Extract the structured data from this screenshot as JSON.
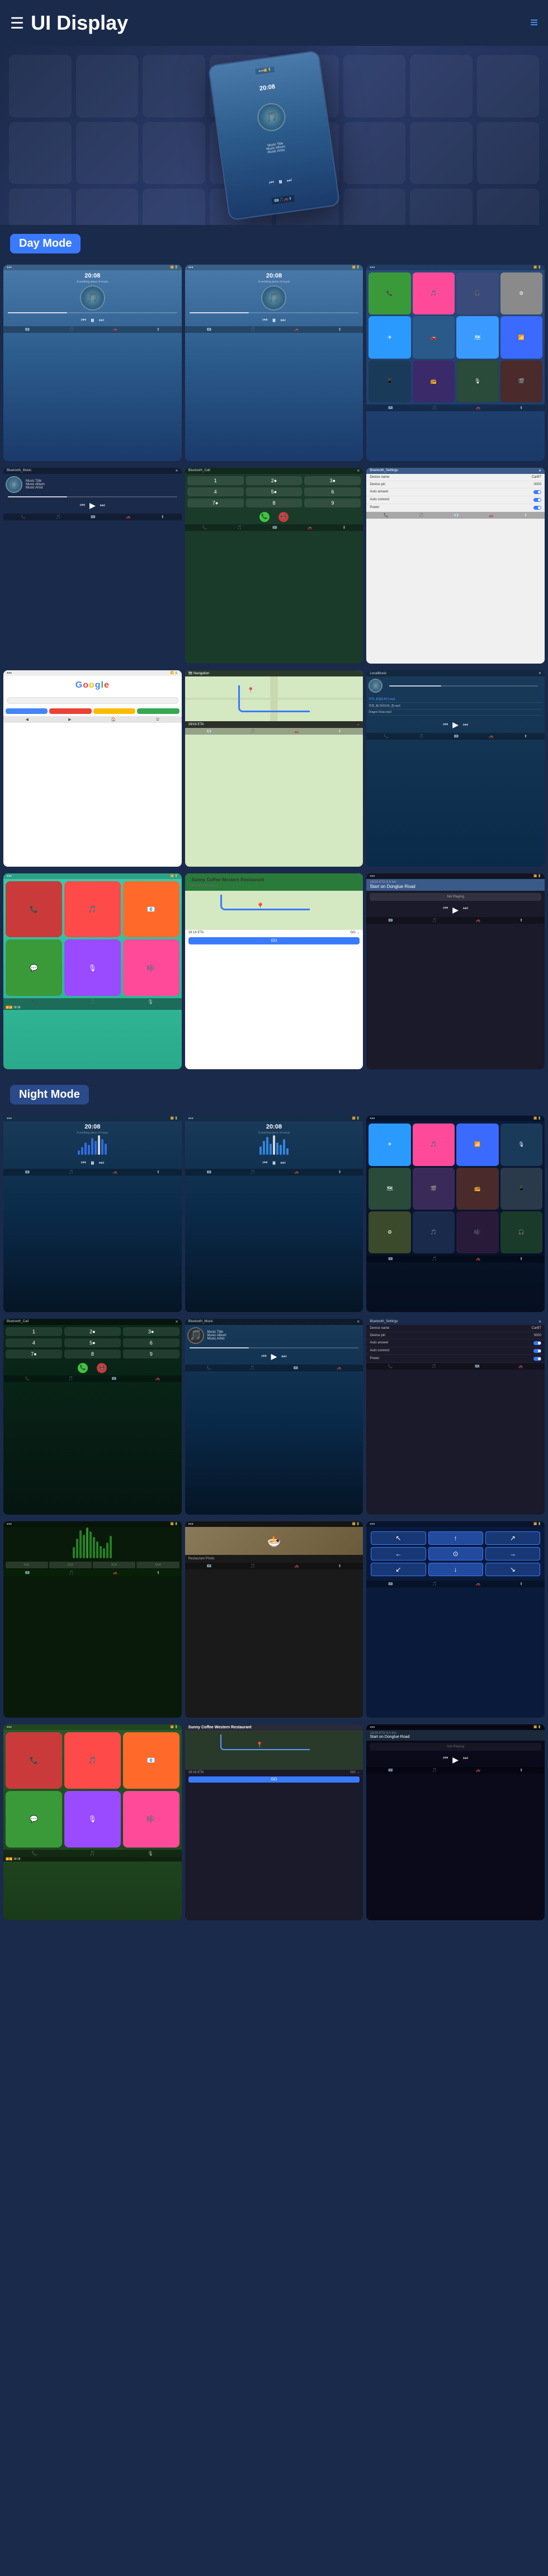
{
  "app": {
    "title": "UI Display",
    "menu_icon": "☰",
    "nav_icon": "≡"
  },
  "modes": {
    "day": "Day Mode",
    "night": "Night Mode"
  },
  "screens": {
    "music": {
      "time": "20:08",
      "song_title": "Music Title",
      "song_album": "Music Album",
      "song_artist": "Music Artist"
    },
    "bluetooth_music": "Bluetooth_Music",
    "bluetooth_call": "Bluetooth_Call",
    "bluetooth_settings": "Bluetooth_Settings",
    "settings": {
      "device_name_label": "Device name",
      "device_name_value": "CarBT",
      "device_pin_label": "Device pin",
      "device_pin_value": "0000",
      "auto_answer_label": "Auto answer",
      "auto_connect_label": "Auto connect",
      "power_label": "Power"
    },
    "google": "Google",
    "local_music": "LocalMusic",
    "navigation": {
      "restaurant": "Sunny Coffee Western Restaurant",
      "eta_label": "19/16 ETA",
      "eta_time": "19/16 ETA  9.0 km",
      "start_on": "Start on Donglue Road",
      "not_playing": "Not Playing",
      "go_label": "GO"
    },
    "phone": {
      "keys": [
        "1",
        "2",
        "3",
        "4",
        "5",
        "6",
        "7",
        "8",
        "9",
        "*",
        "0",
        "#"
      ]
    }
  },
  "file_list": [
    "华年_拟音(LRC).mp3",
    "华年_拟 3月31日_音.mp3",
    "Dragon Rose.mp3"
  ],
  "wave_heights": [
    8,
    14,
    22,
    18,
    30,
    25,
    35,
    28,
    20,
    15,
    25,
    32,
    28,
    22,
    18,
    12,
    20,
    28,
    35,
    30,
    22,
    15,
    10
  ],
  "eq_heights": [
    60,
    80,
    100,
    85,
    70,
    90,
    75,
    95,
    60,
    80,
    70
  ],
  "app_icons": {
    "phone": "📞",
    "music": "🎵",
    "maps": "🗺",
    "messages": "💬",
    "podcast": "🎙",
    "bt": "📶",
    "settings": "⚙",
    "camera": "📷",
    "telegram": "✈",
    "carplay": "🚗",
    "radio": "📻"
  }
}
